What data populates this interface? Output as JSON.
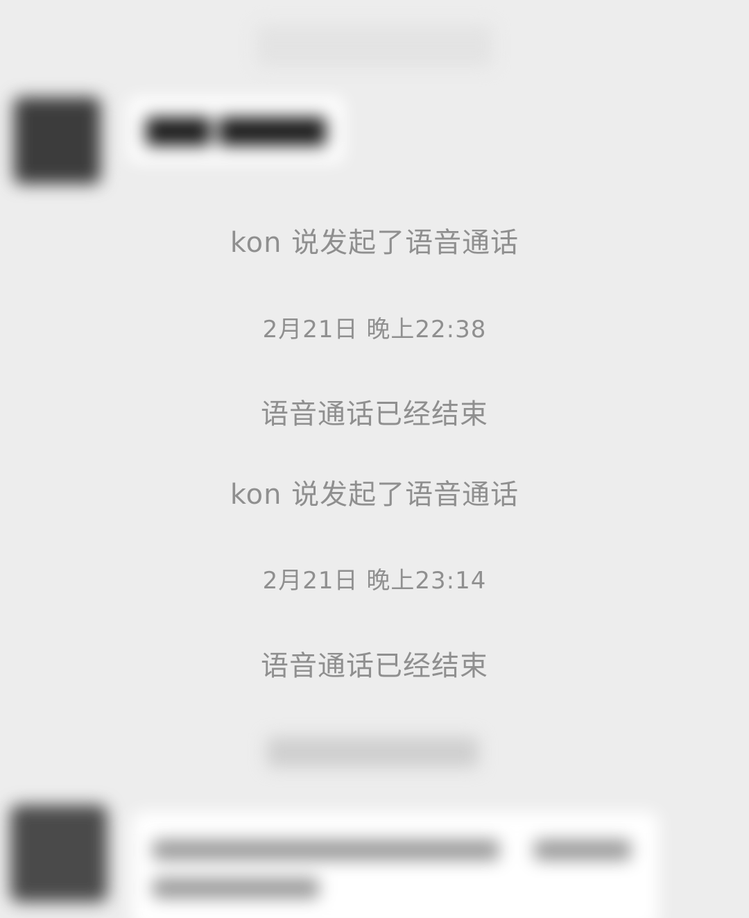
{
  "chat": {
    "messages": [
      {
        "kind": "system",
        "text": "kon 说发起了语音通话"
      },
      {
        "kind": "time",
        "text": "2月21日 晚上22:38"
      },
      {
        "kind": "system",
        "text": "语音通话已经结束"
      },
      {
        "kind": "system",
        "text": "kon 说发起了语音通话"
      },
      {
        "kind": "time",
        "text": "2月21日 晚上23:14"
      },
      {
        "kind": "system",
        "text": "语音通话已经结束"
      }
    ]
  },
  "colors": {
    "background": "#ededed",
    "system_text": "#8f8f8f",
    "bubble": "#ffffff"
  },
  "blurred_regions": [
    "top-timestamp",
    "incoming-message-top",
    "bottom-timestamp",
    "incoming-message-bottom"
  ]
}
